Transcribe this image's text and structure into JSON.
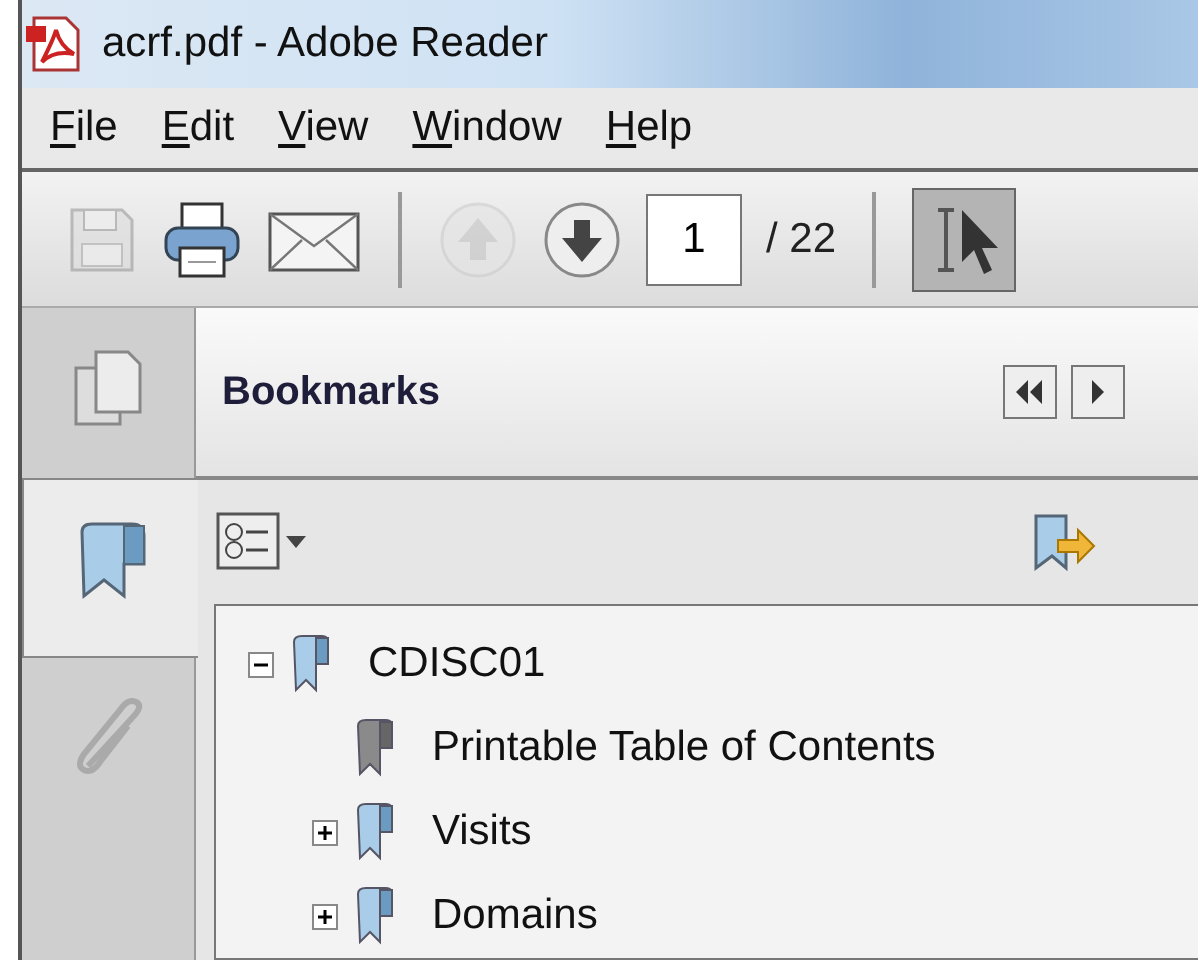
{
  "window": {
    "title": "acrf.pdf - Adobe Reader"
  },
  "menu": [
    {
      "label": "File"
    },
    {
      "label": "Edit"
    },
    {
      "label": "View"
    },
    {
      "label": "Window"
    },
    {
      "label": "Help"
    }
  ],
  "toolbar": {
    "save": {
      "disabled": true
    },
    "previous_page": {
      "disabled": true
    },
    "next_page": {
      "disabled": false
    },
    "page_field": {
      "value": "1"
    },
    "page_total": "/ 22",
    "select_tool": {
      "selected": true
    }
  },
  "side_tabs": [
    {
      "kind": "pages",
      "selected": false
    },
    {
      "kind": "bookmarks",
      "selected": true
    },
    {
      "kind": "attachments",
      "selected": false
    }
  ],
  "panel": {
    "title": "Bookmarks"
  },
  "tree": [
    {
      "label": "CDISC01",
      "kind": "group",
      "expanded": true,
      "children": [
        {
          "label": "Printable Table of Contents",
          "kind": "leaf"
        },
        {
          "label": "Visits",
          "kind": "group",
          "expanded": false
        },
        {
          "label": "Domains",
          "kind": "group",
          "expanded": false
        }
      ]
    }
  ]
}
